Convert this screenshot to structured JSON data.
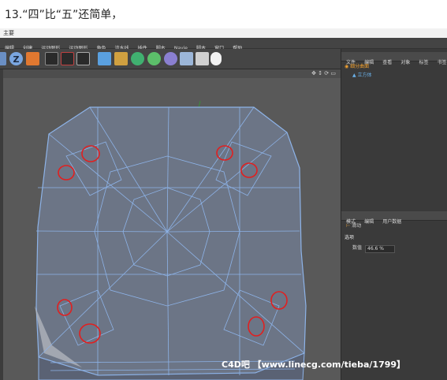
{
  "heading": "13.“四”比“五”还简单，",
  "app_title": "主要",
  "menu": [
    "编辑",
    "创建",
    "运动图形",
    "运动图形",
    "角色",
    "流水线",
    "插件",
    "脚本",
    "Naviе",
    "脚本",
    "窗口",
    "帮助"
  ],
  "toolbar_icons": [
    "z-axis-lock-icon",
    "coordinate-icon",
    "render-view-icon",
    "render-icon",
    "render-settings-icon",
    "cube-icon",
    "pen-icon",
    "subdivision-icon",
    "array-icon",
    "deformer-icon",
    "floor-icon",
    "camera-icon",
    "light-icon"
  ],
  "object_manager": {
    "tabs": [
      "文件",
      "编辑",
      "查看",
      "对象",
      "标签",
      "书签"
    ],
    "objects": [
      {
        "name": "细分曲面",
        "color": "#f0a030"
      },
      {
        "name": "立方体",
        "color": "#6ab0e8"
      }
    ]
  },
  "attribute_manager": {
    "tabs": [
      "模式",
      "编辑",
      "用户数据"
    ],
    "tool_name": "滑动",
    "section": "选项",
    "field_label": "数值",
    "field_value": "46.6 %"
  },
  "watermark": "C4D吧 【www.linecg.com/tieba/1799】"
}
